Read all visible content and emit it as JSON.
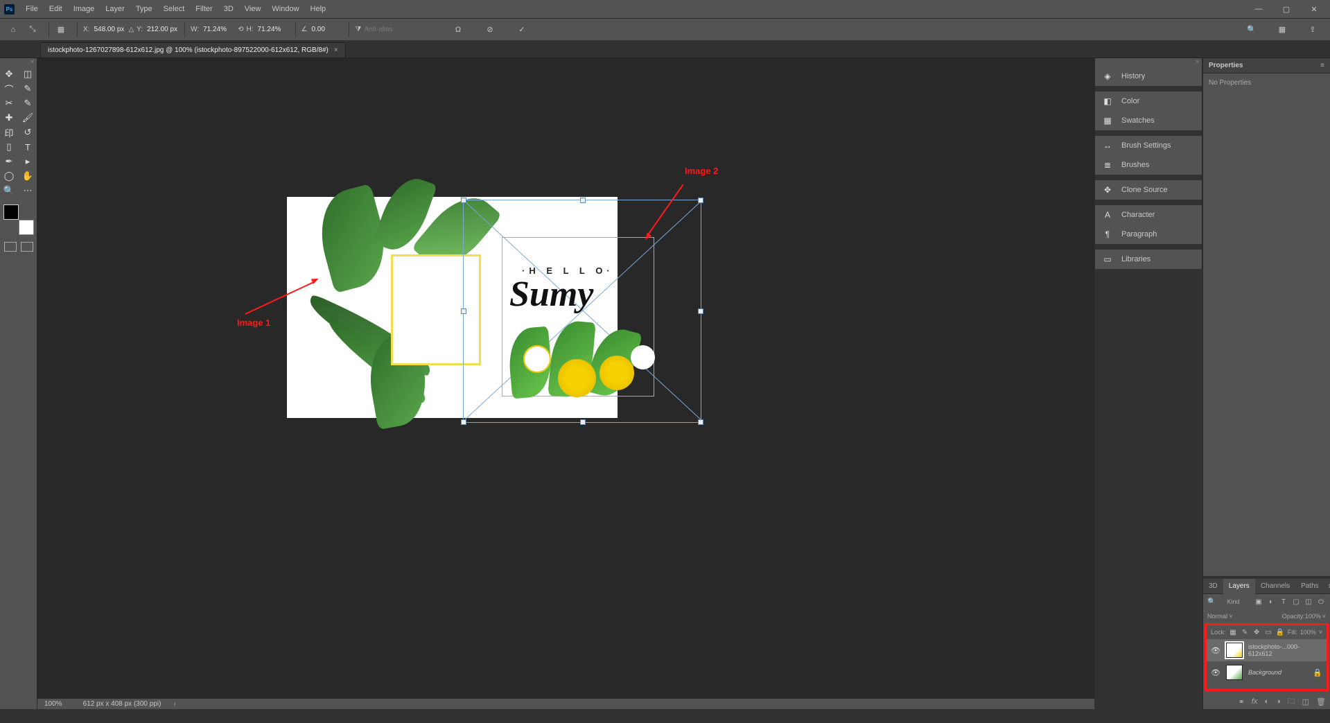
{
  "menu": [
    "File",
    "Edit",
    "Image",
    "Layer",
    "Type",
    "Select",
    "Filter",
    "3D",
    "View",
    "Window",
    "Help"
  ],
  "options": {
    "x_lbl": "X:",
    "x": "548.00 px",
    "y_lbl": "Y:",
    "y": "212.00 px",
    "w_lbl": "W:",
    "w": "71.24%",
    "h_lbl": "H:",
    "h": "71.24%",
    "angle_lbl": "",
    "angle": "0.00",
    "interp_lbl": "",
    "interp": "",
    "antialias": "Anti-alias"
  },
  "tab_title": "istockphoto-1267027898-612x612.jpg @ 100% (istockphoto-897522000-612x612, RGB/8#)",
  "annotations": {
    "img1": "Image 1",
    "img2": "Image 2"
  },
  "img2": {
    "hello": "·H E L L O·",
    "sumy": "Sumy"
  },
  "dock": [
    "History",
    "Color",
    "Swatches",
    "Brush Settings",
    "Brushes",
    "Clone Source",
    "Character",
    "Paragraph",
    "Libraries"
  ],
  "props": {
    "title": "Properties",
    "body": "No Properties"
  },
  "layer_tabs": [
    "3D",
    "Layers",
    "Channels",
    "Paths"
  ],
  "layer_filter_kind": "Kind",
  "blend": {
    "mode": "Normal",
    "op_lbl": "Opacity:",
    "op": "100%"
  },
  "lock": {
    "lbl": "Lock:",
    "fill_lbl": "Fill:",
    "fill": "100%"
  },
  "layers": [
    {
      "name": "istockphoto-...000-612x612",
      "locked": false
    },
    {
      "name": "Background",
      "locked": true,
      "italic": true
    }
  ],
  "status": {
    "zoom": "100%",
    "dims": "612 px x 408 px (300 ppi)"
  }
}
